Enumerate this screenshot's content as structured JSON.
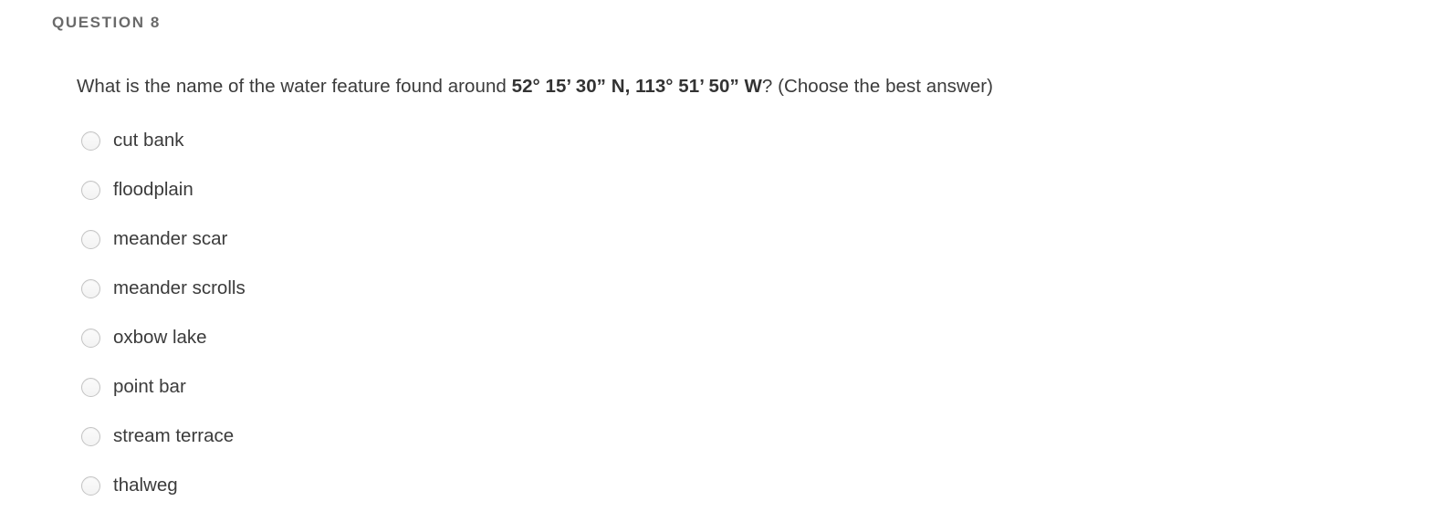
{
  "question": {
    "header": "QUESTION 8",
    "prompt_prefix": "What is the name of the water feature found around ",
    "coordinates": "52° 15’ 30” N, 113° 51’ 50” W",
    "prompt_suffix": "? (Choose the best answer)",
    "options": [
      {
        "label": "cut bank",
        "selected": false
      },
      {
        "label": "floodplain",
        "selected": false
      },
      {
        "label": "meander scar",
        "selected": false
      },
      {
        "label": "meander scrolls",
        "selected": false
      },
      {
        "label": "oxbow lake",
        "selected": false
      },
      {
        "label": "point bar",
        "selected": false
      },
      {
        "label": "stream terrace",
        "selected": false
      },
      {
        "label": "thalweg",
        "selected": false
      }
    ]
  },
  "colors": {
    "background": "#ffffff",
    "header_text": "#6a6a6a",
    "body_text": "#3b3b3b",
    "radio_border": "#c3c3c3"
  }
}
